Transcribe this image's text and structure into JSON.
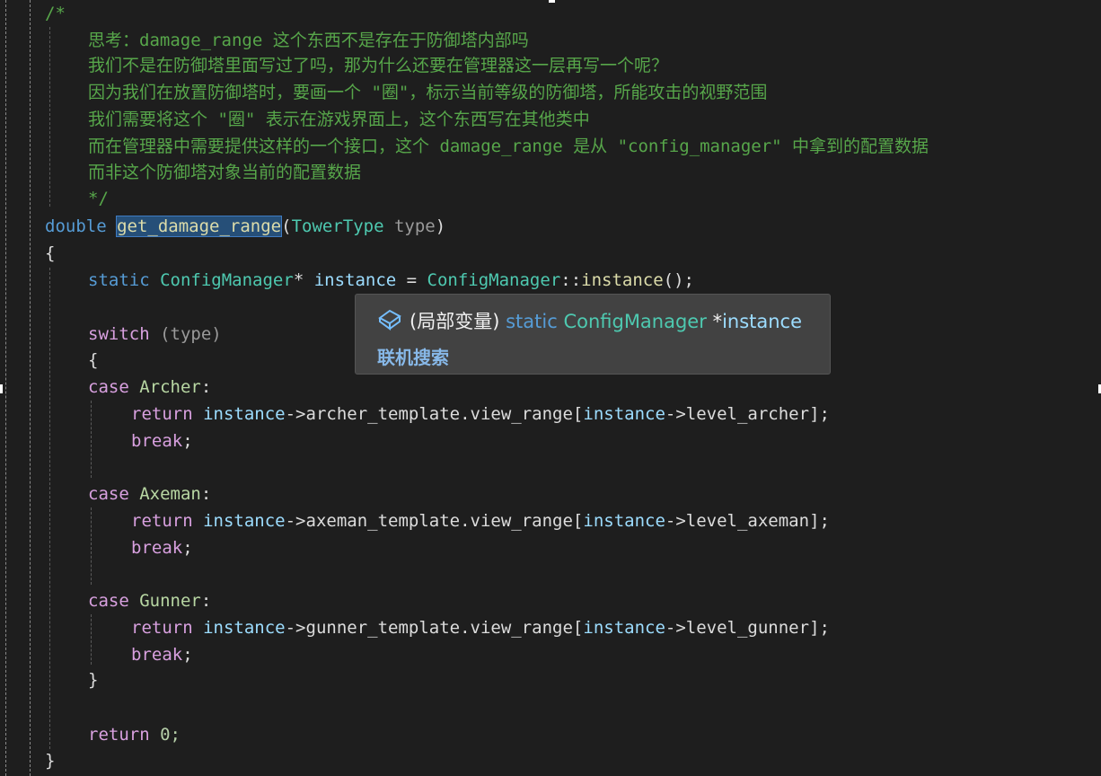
{
  "code": {
    "l1": "/*",
    "l2": "思考：damage_range 这个东西不是存在于防御塔内部吗",
    "l3": "我们不是在防御塔里面写过了吗，那为什么还要在管理器这一层再写一个呢？",
    "l4": "因为我们在放置防御塔时，要画一个 \"圈\"，标示当前等级的防御塔，所能攻击的视野范围",
    "l5": "我们需要将这个 \"圈\" 表示在游戏界面上，这个东西写在其他类中",
    "l6": "而在管理器中需要提供这样的一个接口，这个 damage_range 是从 \"config_manager\" 中拿到的配置数据",
    "l7": "而非这个防御塔对象当前的配置数据",
    "l8": "*/",
    "sig_double": "double",
    "sig_name": "get_damage_range",
    "sig_open": "(",
    "sig_type": "TowerType",
    "sig_param": "type",
    "sig_close": ")",
    "brace_open": "{",
    "s_static": "static",
    "s_type": "ConfigManager",
    "s_star": "* ",
    "s_var": "instance",
    "s_eq": " = ",
    "s_class": "ConfigManager",
    "s_colon": "::",
    "s_fn": "instance",
    "s_call": "();",
    "sw_kw": "switch",
    "sw_arg": " (type)",
    "sw_open": "{",
    "case_kw": "case",
    "case_archer": "Archer",
    "case_axeman": "Axeman",
    "case_gunner": "Gunner",
    "colon": ":",
    "ret_kw": "return",
    "arrow": "->",
    "archer_tpl": "archer_template.view_range",
    "archer_lvl": "level_archer",
    "axeman_tpl": "axeman_template.view_range",
    "axeman_lvl": "level_axeman",
    "gunner_tpl": "gunner_template.view_range",
    "gunner_lvl": "level_gunner",
    "bracket_open": "[",
    "bracket_close": "];",
    "break_kw": "break",
    "semi": ";",
    "sw_close": "}",
    "ret_zero": "0;",
    "brace_close": "}"
  },
  "tooltip": {
    "icon": "local-variable-icon",
    "scope": "(局部变量)",
    "keyword": "static",
    "type": "ConfigManager",
    "star": "*",
    "name": "instance",
    "search": "联机搜索"
  },
  "colors": {
    "background": "#1e1e1e",
    "comment": "#57a64a",
    "keyword": "#569cd6",
    "control": "#d8a0df",
    "type": "#4ec9b0",
    "function": "#dcdcaa",
    "variable": "#9cdcfe",
    "enum": "#b8d7a3",
    "selection": "#264f78"
  }
}
